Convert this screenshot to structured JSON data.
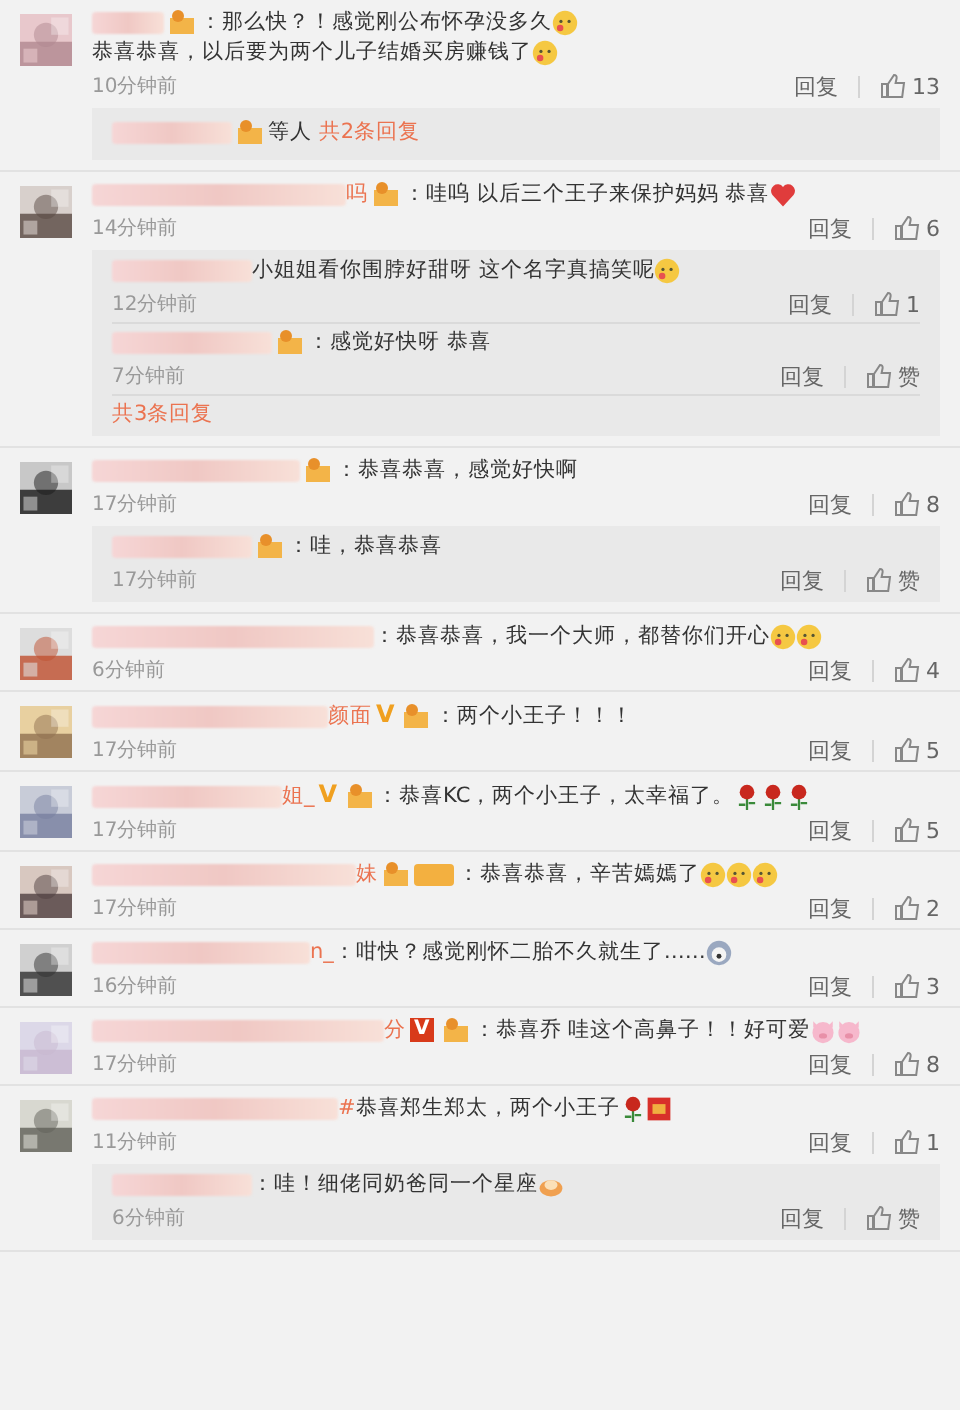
{
  "comments": [
    {
      "badges": [
        {
          "kind": "medal"
        }
      ],
      "content": [
        {
          "kind": "text",
          "text": "：那么快？！感觉刚公布怀孕没多久"
        },
        {
          "kind": "face"
        },
        {
          "kind": "text",
          "text": "恭喜恭喜，以后要为两个儿子结婚买房赚"
        },
        {
          "kind": "text",
          "text": "钱了"
        },
        {
          "kind": "face"
        }
      ],
      "time": "10分钟前",
      "reply": "回复",
      "likes": "13",
      "summary": {
        "badges": [
          {
            "kind": "medal"
          }
        ],
        "who": "等人",
        "link": "共2条回复"
      }
    },
    {
      "name_tail": "吗",
      "badges": [
        {
          "kind": "medal"
        }
      ],
      "content": [
        {
          "kind": "text",
          "text": "：哇呜 以后三个王子来保护妈妈 恭喜"
        },
        {
          "kind": "heart"
        }
      ],
      "time": "14分钟前",
      "reply": "回复",
      "likes": "6",
      "replies": [
        {
          "content": [
            {
              "kind": "text",
              "text": "小姐姐看你围脖好甜呀 这个名字真搞笑呢"
            },
            {
              "kind": "face"
            }
          ],
          "time": "12分钟前",
          "reply": "回复",
          "likes": "1"
        },
        {
          "badges": [
            {
              "kind": "medal"
            }
          ],
          "content": [
            {
              "kind": "text",
              "text": "：感觉好快呀 恭喜"
            }
          ],
          "time": "7分钟前",
          "reply": "回复",
          "likes": "赞"
        }
      ],
      "more_link": "共3条回复"
    },
    {
      "badges": [
        {
          "kind": "medal"
        }
      ],
      "content": [
        {
          "kind": "text",
          "text": "：恭喜恭喜，感觉好快啊"
        }
      ],
      "time": "17分钟前",
      "reply": "回复",
      "likes": "8",
      "replies": [
        {
          "badges": [
            {
              "kind": "medal"
            }
          ],
          "content": [
            {
              "kind": "text",
              "text": "：哇，恭喜恭喜"
            }
          ],
          "time": "17分钟前",
          "reply": "回复",
          "likes": "赞"
        }
      ]
    },
    {
      "content": [
        {
          "kind": "text",
          "text": "：恭喜恭喜，我一个大师，都替你们开心"
        },
        {
          "kind": "face"
        },
        {
          "kind": "face"
        }
      ],
      "time": "6分钟前",
      "reply": "回复",
      "likes": "4"
    },
    {
      "name_tail": "颜面",
      "badges": [
        {
          "kind": "vip",
          "text": "V"
        },
        {
          "kind": "medal"
        }
      ],
      "content": [
        {
          "kind": "text",
          "text": "：两个小王子！！！"
        }
      ],
      "time": "17分钟前",
      "reply": "回复",
      "likes": "5"
    },
    {
      "name_tail": "姐_",
      "badges": [
        {
          "kind": "vip",
          "text": "V"
        },
        {
          "kind": "medal"
        }
      ],
      "content": [
        {
          "kind": "text",
          "text": "：恭喜KC，两个小王子，太幸福了。"
        },
        {
          "kind": "rose"
        },
        {
          "kind": "rose"
        },
        {
          "kind": "rose"
        }
      ],
      "time": "17分钟前",
      "reply": "回复",
      "likes": "5"
    },
    {
      "name_tail": "妹",
      "badges": [
        {
          "kind": "fan"
        }
      ],
      "content": [
        {
          "kind": "text",
          "text": "：恭喜恭喜，辛苦嫣嫣了"
        },
        {
          "kind": "face"
        },
        {
          "kind": "face"
        },
        {
          "kind": "face"
        }
      ],
      "time": "17分钟前",
      "reply": "回复",
      "likes": "2"
    },
    {
      "name_tail": "n_",
      "content": [
        {
          "kind": "text",
          "text": "：咁快？感觉刚怀二胎不久就生了……"
        },
        {
          "kind": "round"
        }
      ],
      "time": "16分钟前",
      "reply": "回复",
      "likes": "3"
    },
    {
      "name_tail": "分",
      "badges": [
        {
          "kind": "vip-red",
          "text": "V"
        },
        {
          "kind": "medal"
        }
      ],
      "content": [
        {
          "kind": "text",
          "text": "：恭喜乔 哇这个高鼻子！！好可爱"
        },
        {
          "kind": "pig"
        },
        {
          "kind": "pig"
        }
      ],
      "time": "17分钟前",
      "reply": "回复",
      "likes": "8"
    },
    {
      "name_tail": "#",
      "content": [
        {
          "kind": "text",
          "text": "恭喜郑生郑太，两个小王子"
        },
        {
          "kind": "rose"
        },
        {
          "kind": "envelope"
        }
      ],
      "time": "11分钟前",
      "reply": "回复",
      "likes": "1",
      "replies": [
        {
          "content": [
            {
              "kind": "text",
              "text": "：哇！细佬同奶爸同一个星座"
            },
            {
              "kind": "hands"
            }
          ],
          "time": "6分钟前",
          "reply": "回复",
          "likes": "赞"
        }
      ]
    }
  ]
}
